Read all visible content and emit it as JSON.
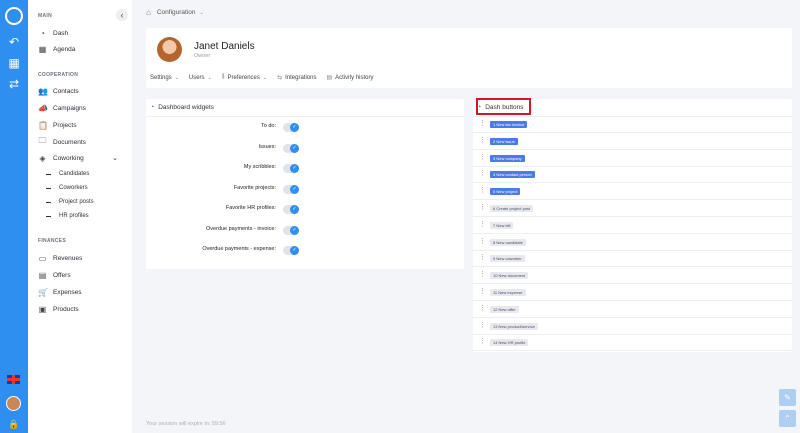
{
  "rail": {
    "icons": [
      "logo-icon",
      "back-icon",
      "grid-icon",
      "toggle-icon"
    ]
  },
  "sidebar": {
    "section_main": "MAIN",
    "section_cooperation": "COOPERATION",
    "section_finances": "FINANCES",
    "main_items": [
      {
        "label": "Dash",
        "icon": "speedometer-icon"
      },
      {
        "label": "Agenda",
        "icon": "calendar-icon"
      }
    ],
    "cooperation_items": [
      {
        "label": "Contacts",
        "icon": "contacts-icon"
      },
      {
        "label": "Campaigns",
        "icon": "megaphone-icon"
      },
      {
        "label": "Projects",
        "icon": "clipboard-icon"
      },
      {
        "label": "Documents",
        "icon": "folder-icon"
      },
      {
        "label": "Coworking",
        "icon": "layers-icon"
      }
    ],
    "coworking_sub": [
      "Candidates",
      "Coworkers",
      "Project posts",
      "HR profiles"
    ],
    "finance_items": [
      {
        "label": "Revenues",
        "icon": "cash-icon"
      },
      {
        "label": "Offers",
        "icon": "offer-icon"
      },
      {
        "label": "Expenses",
        "icon": "cart-icon"
      },
      {
        "label": "Products",
        "icon": "box-icon"
      }
    ]
  },
  "breadcrumb": {
    "label": "Configuration"
  },
  "profile": {
    "name": "Janet Daniels",
    "role": "Owner",
    "tabs": [
      {
        "label": "Settings",
        "dropdown": true
      },
      {
        "label": "Users",
        "dropdown": true
      },
      {
        "label": "Preferences",
        "dropdown": true
      },
      {
        "label": "Integrations",
        "dropdown": false
      },
      {
        "label": "Activity history",
        "dropdown": false
      }
    ]
  },
  "dashboard_widgets": {
    "title": "Dashboard widgets",
    "items": [
      {
        "label": "To do:",
        "enabled": true
      },
      {
        "label": "Issues:",
        "enabled": true
      },
      {
        "label": "My scribbles:",
        "enabled": true
      },
      {
        "label": "Favorite projects:",
        "enabled": true
      },
      {
        "label": "Favorite HR profiles:",
        "enabled": true
      },
      {
        "label": "Overdue payments - invoice:",
        "enabled": true
      },
      {
        "label": "Overdue payments - expense:",
        "enabled": true
      }
    ]
  },
  "dash_buttons": {
    "title": "Dash buttons",
    "items": [
      {
        "label": "1 New tax invoice",
        "active": true
      },
      {
        "label": "2 New issue",
        "active": true
      },
      {
        "label": "3 New company",
        "active": true
      },
      {
        "label": "4 New contact person",
        "active": true
      },
      {
        "label": "5 New project",
        "active": true
      },
      {
        "label": "6 Create project post",
        "active": false
      },
      {
        "label": "7 New bill",
        "active": false
      },
      {
        "label": "8 New candidate",
        "active": false
      },
      {
        "label": "9 New coworker",
        "active": false
      },
      {
        "label": "10 New document",
        "active": false
      },
      {
        "label": "11 New expense",
        "active": false
      },
      {
        "label": "12 New offer",
        "active": false
      },
      {
        "label": "13 New product/service",
        "active": false
      },
      {
        "label": "14 New HR profile",
        "active": false
      }
    ]
  },
  "session": {
    "label": "Your session will expire in: 59:56"
  },
  "colors": {
    "accent": "#2f8ff0",
    "pill_active": "#4a7be6",
    "highlight": "#d0182b"
  }
}
